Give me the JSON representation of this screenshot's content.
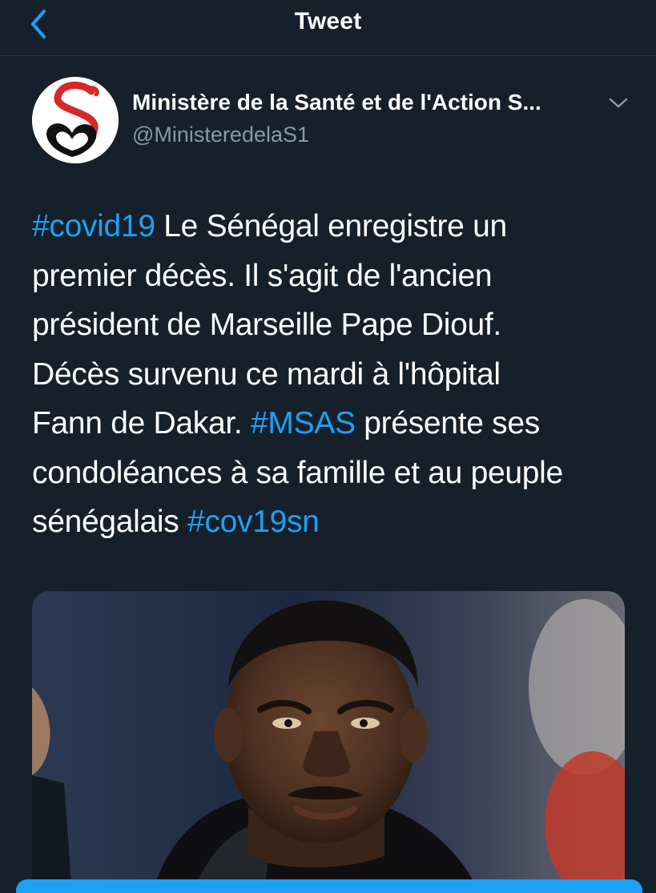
{
  "header": {
    "title": "Tweet"
  },
  "author": {
    "name": "Ministère de la Santé et de l'Action S...",
    "handle": "@MinisteredelaS1"
  },
  "tweet": {
    "lines": [
      [
        {
          "text": "#covid19",
          "hashtag": true
        },
        {
          "text": " Le  Sénégal enregistre un",
          "hashtag": false
        }
      ],
      [
        {
          "text": "premier décès. Il s'agit de l'ancien",
          "hashtag": false
        }
      ],
      [
        {
          "text": "président de Marseille Pape Diouf.",
          "hashtag": false
        }
      ],
      [
        {
          "text": "Décès survenu ce mardi à l'hôpital",
          "hashtag": false
        }
      ],
      [
        {
          "text": "Fann de Dakar. ",
          "hashtag": false
        },
        {
          "text": "#MSAS",
          "hashtag": true
        },
        {
          "text": " présente ses",
          "hashtag": false
        }
      ],
      [
        {
          "text": "condoléances à sa famille et au peuple",
          "hashtag": false
        }
      ],
      [
        {
          "text": "sénégalais ",
          "hashtag": false
        },
        {
          "text": "#cov19sn",
          "hashtag": true
        }
      ]
    ]
  },
  "icons": {
    "back": "chevron-left-icon",
    "more": "chevron-down-icon"
  },
  "colors": {
    "background": "#15202b",
    "accent": "#1da1f2",
    "secondary_text": "#8899a6",
    "divider": "#2f3b47",
    "logo_red": "#d62828"
  }
}
